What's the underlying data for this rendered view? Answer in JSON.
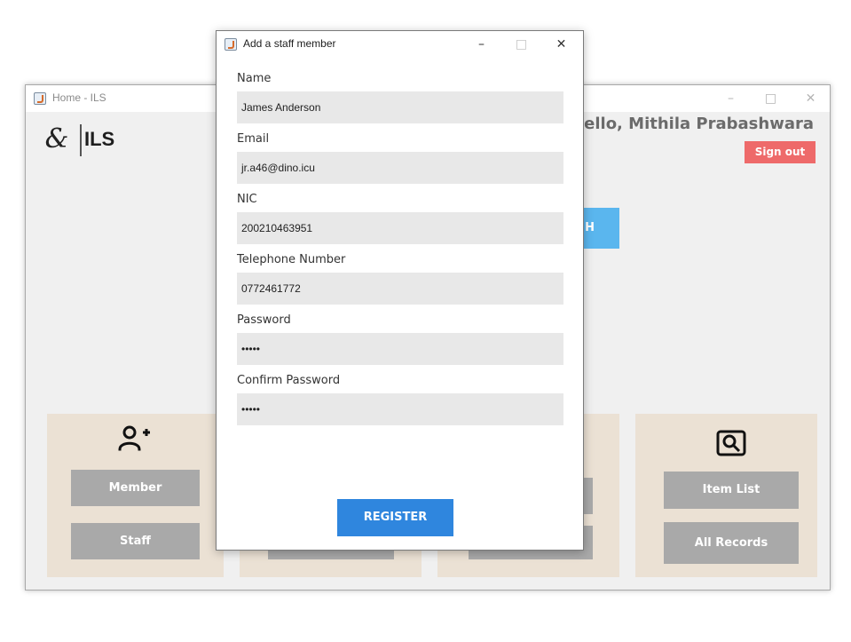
{
  "main_window": {
    "title": "Home - ILS",
    "controls": {
      "minimize": "–",
      "maximize": "□",
      "close": "✕"
    },
    "logo": {
      "mark": "&",
      "text": "ILS"
    },
    "greeting": "Hello, Mithila Prabashwara",
    "sign_out_label": "Sign out",
    "search_label_partial": "H",
    "cards": [
      {
        "icon": "add-user-icon",
        "buttons": [
          "Member",
          "Staff"
        ]
      },
      {
        "icon": "hidden",
        "buttons": []
      },
      {
        "icon": "hidden",
        "buttons": []
      },
      {
        "icon": "search-image-icon",
        "buttons": [
          "Item List",
          "All Records"
        ]
      }
    ]
  },
  "dialog": {
    "title": "Add a staff member",
    "controls": {
      "minimize": "–",
      "maximize": "□",
      "close": "✕"
    },
    "fields": {
      "name": {
        "label": "Name",
        "value": "James Anderson"
      },
      "email": {
        "label": "Email",
        "value": "jr.a46@dino.icu"
      },
      "nic": {
        "label": "NIC",
        "value": "200210463951"
      },
      "telephone": {
        "label": "Telephone Number",
        "value": "0772461772"
      },
      "password": {
        "label": "Password",
        "value": "•••••"
      },
      "confirm_password": {
        "label": "Confirm Password",
        "value": "•••••"
      }
    },
    "register_label": "REGISTER"
  },
  "colors": {
    "accent_blue": "#2f86de",
    "search_blue": "#5ab6ee",
    "sign_out_red": "#ee6a6a",
    "card_bg": "#ebe1d4",
    "card_button": "#a9a9a9"
  }
}
